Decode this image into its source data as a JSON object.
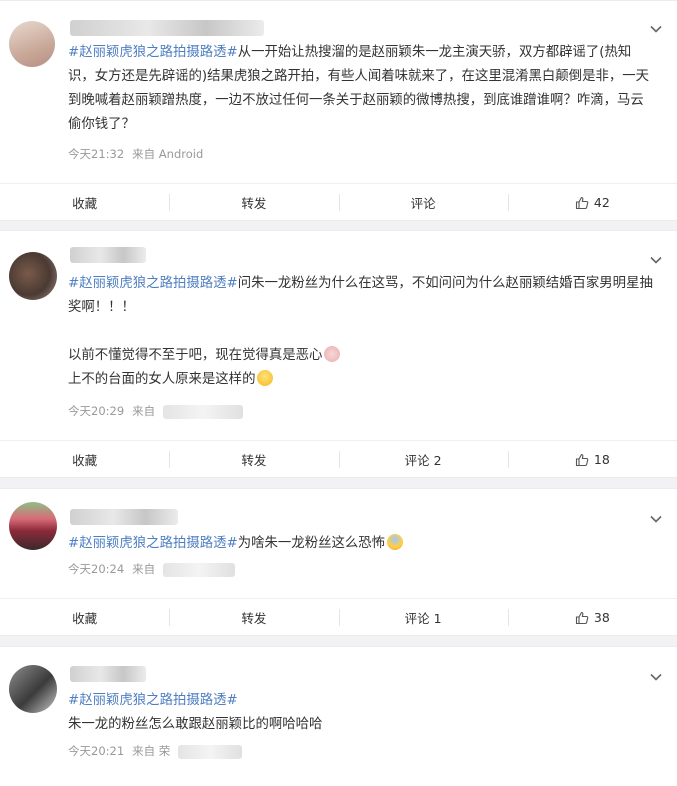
{
  "comments": [
    {
      "hashtag": "#赵丽颖虎狼之路拍摄路透#",
      "body": "从一开始让热搜溜的是赵丽颖朱一龙主演天骄，双方都辟谣了(热知识，女方还是先辟谣的)结果虎狼之路开拍，有些人闻着味就来了，在这里混淆黑白颠倒是非，一天到晚喊着赵丽颖蹭热度，一边不放过任何一条关于赵丽颖的微博热搜，到底谁蹭谁啊？咋滴，马云偷你钱了？",
      "time": "今天21:32",
      "source": "来自 Android",
      "actions": {
        "favorite": "收藏",
        "repost": "转发",
        "comment": "评论",
        "likes": "42"
      }
    },
    {
      "hashtag": "#赵丽颖虎狼之路拍摄路透#",
      "body": "问朱一龙粉丝为什么在这骂，不如问问为什么赵丽颖结婚百家男明星抽奖啊！！！",
      "line2": "以前不懂觉得不至于吧，现在觉得真是恶心",
      "line3": "上不的台面的女人原来是这样的",
      "time": "今天20:29",
      "source": "来自",
      "actions": {
        "favorite": "收藏",
        "repost": "转发",
        "comment": "评论 2",
        "likes": "18"
      }
    },
    {
      "hashtag": "#赵丽颖虎狼之路拍摄路透#",
      "body": "为啥朱一龙粉丝这么恐怖",
      "time": "今天20:24",
      "source": "来自",
      "actions": {
        "favorite": "收藏",
        "repost": "转发",
        "comment": "评论 1",
        "likes": "38"
      }
    },
    {
      "hashtag": "#赵丽颖虎狼之路拍摄路透#",
      "body": "朱一龙的粉丝怎么敢跟赵丽颖比的啊哈哈哈",
      "time": "今天20:21",
      "source": "来自 荣"
    }
  ],
  "colors": {
    "hashtag": "#4f7fc2",
    "meta": "#999999",
    "text": "#333333"
  }
}
